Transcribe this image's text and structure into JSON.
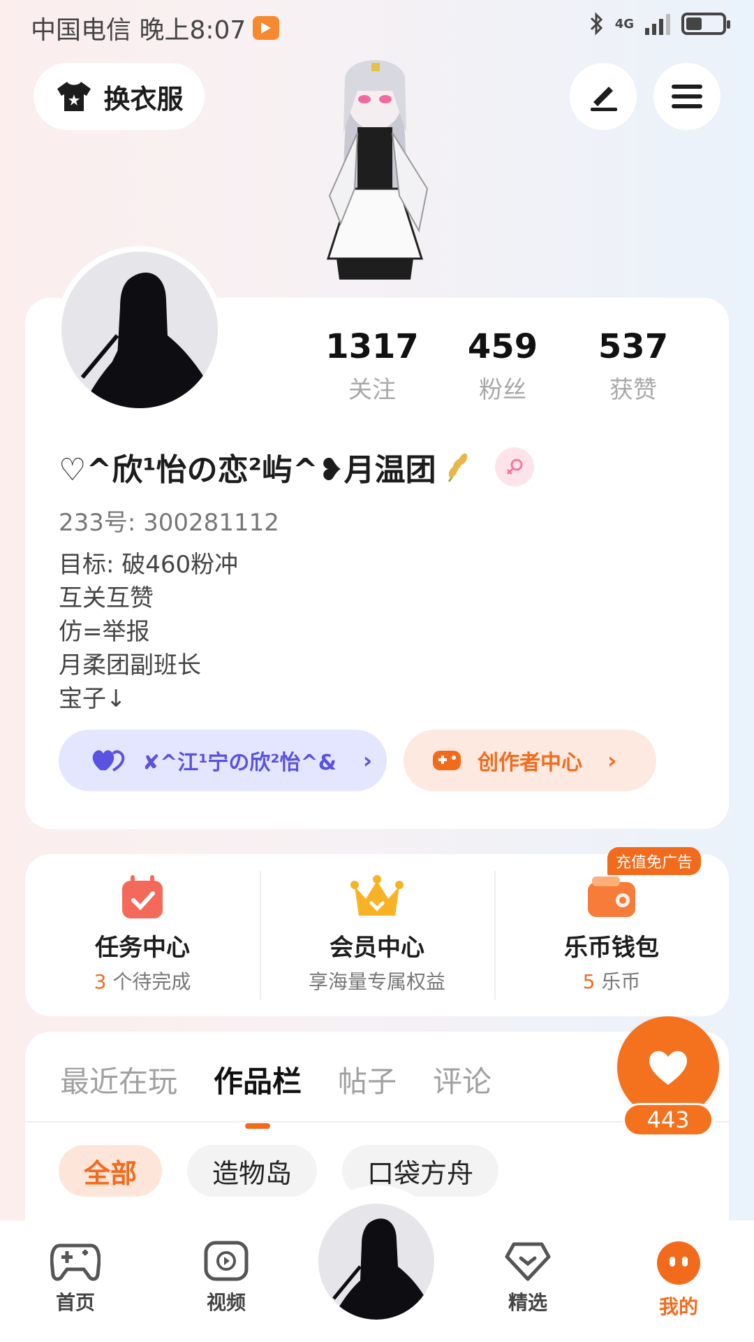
{
  "status_bar": {
    "carrier_time": "中国电信 晚上8:07",
    "network": "4G"
  },
  "header": {
    "outfit_label": "换衣服"
  },
  "profile": {
    "stats": [
      {
        "value": "1317",
        "label": "关注"
      },
      {
        "value": "459",
        "label": "粉丝"
      },
      {
        "value": "537",
        "label": "获赞"
      }
    ],
    "nickname": "♡^欣¹怡の恋²屿^❥月温团",
    "uid": "233号:  300281112",
    "bio": [
      "目标:  破460粉冲",
      "互关互赞",
      "仿=举报",
      "月柔团副班长",
      "宝子↓"
    ],
    "link_pill": "✘^江¹宁の欣²怡^&",
    "creator_pill": "创作者中心"
  },
  "services": [
    {
      "title": "任务中心",
      "count": "3",
      "sub": " 个待完成"
    },
    {
      "title": "会员中心",
      "sub": "享海量专属权益"
    },
    {
      "title": "乐币钱包",
      "count": "5",
      "sub": " 乐币",
      "badge": "充值免广告"
    }
  ],
  "tabs": [
    "最近在玩",
    "作品栏",
    "帖子",
    "评论"
  ],
  "active_tab": "作品栏",
  "chips": [
    "全部",
    "造物岛",
    "口袋方舟"
  ],
  "fab": {
    "count": "443"
  },
  "bottom_nav": [
    {
      "label": "首页",
      "icon": "gamepad-icon"
    },
    {
      "label": "视频",
      "icon": "video-icon"
    },
    {
      "label": "",
      "icon": "avatar"
    },
    {
      "label": "精选",
      "icon": "heart-tag-icon"
    },
    {
      "label": "我的",
      "icon": "face-icon"
    }
  ],
  "colors": {
    "accent": "#f26b1d",
    "purple": "#5a52e0"
  }
}
